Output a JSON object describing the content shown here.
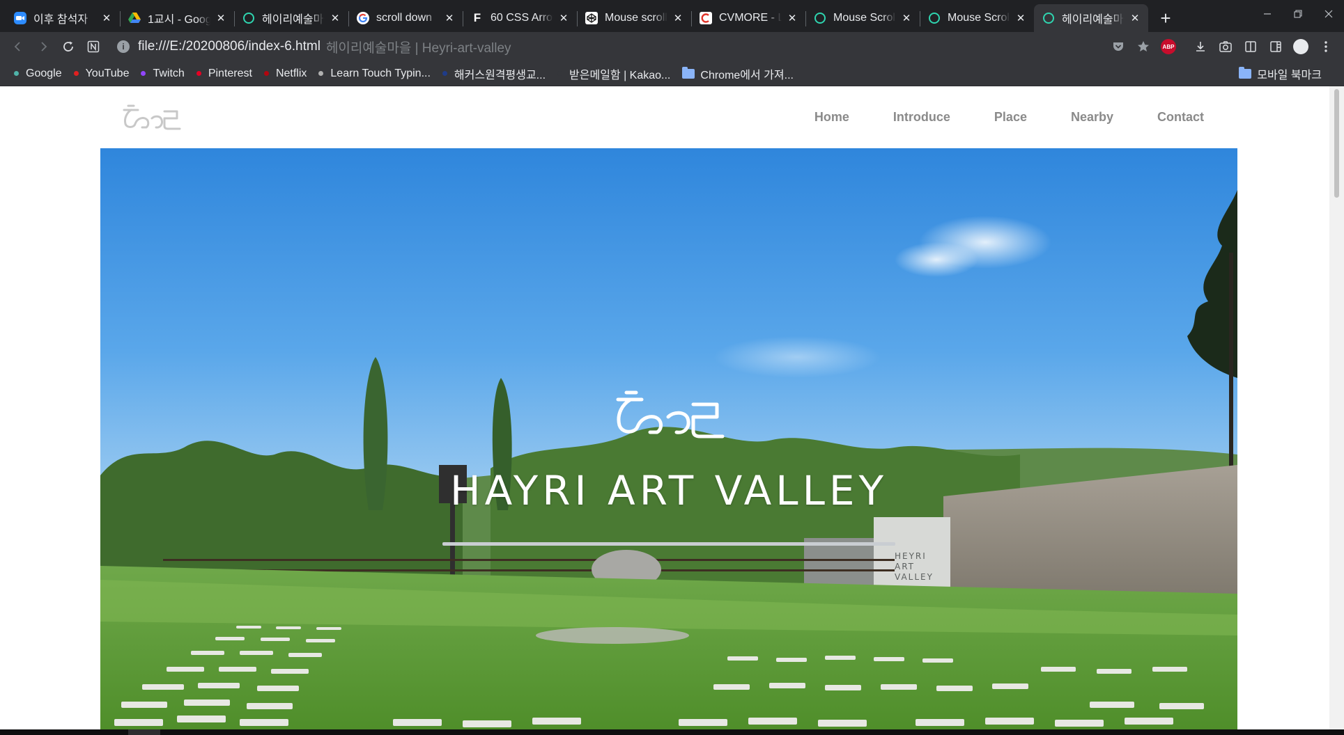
{
  "browser": {
    "tabs": [
      {
        "title": "이후 참석자",
        "icon": "zoom-icon",
        "active": false
      },
      {
        "title": "1교시 - Google",
        "icon": "google-drive-icon",
        "active": false
      },
      {
        "title": "헤이리예술마을",
        "icon": "circle-icon",
        "active": false
      },
      {
        "title": "scroll down",
        "icon": "google-icon",
        "active": false
      },
      {
        "title": "60 CSS Arrows",
        "icon": "f-letter-icon",
        "active": false
      },
      {
        "title": "Mouse scroll",
        "icon": "codepen-icon",
        "active": false
      },
      {
        "title": "CVMORE - L",
        "icon": "cvmore-icon",
        "active": false
      },
      {
        "title": "Mouse Scroll",
        "icon": "circle-icon",
        "active": false
      },
      {
        "title": "Mouse Scroll",
        "icon": "circle-icon",
        "active": false
      },
      {
        "title": "헤이리예술마을",
        "icon": "circle-icon",
        "active": true
      }
    ],
    "new_tab_label": "+",
    "address": {
      "url": "file:///E:/20200806/index-6.html",
      "page_title": "헤이리예술마을 | Heyri-art-valley"
    },
    "bookmarks": [
      {
        "label": "Google",
        "dot_color": "#4fb3a9"
      },
      {
        "label": "YouTube",
        "dot_color": "#e02020"
      },
      {
        "label": "Twitch",
        "dot_color": "#9146ff"
      },
      {
        "label": "Pinterest",
        "dot_color": "#e60023"
      },
      {
        "label": "Netflix",
        "dot_color": "#b1060f"
      },
      {
        "label": "Learn Touch Typin...",
        "dot_color": "#b0b0b0"
      },
      {
        "label": "해커스원격평생교...",
        "dot_color": "#1f3c88"
      },
      {
        "label": "받은메일함 | Kakao...",
        "dot_color": "#35363a"
      }
    ],
    "bookmark_folder": "Chrome에서 가져...",
    "mobile_bookmarks": "모바일 북마크"
  },
  "site": {
    "nav": [
      {
        "label": "Home"
      },
      {
        "label": "Introduce"
      },
      {
        "label": "Place"
      },
      {
        "label": "Nearby"
      },
      {
        "label": "Contact"
      }
    ],
    "hero": {
      "title": "HAYRI ART VALLEY"
    }
  },
  "colors": {
    "browser_bg": "#202124",
    "toolbar_bg": "#35363a",
    "nav_text": "#8a8a8a",
    "hero_title": "#ffffff"
  }
}
